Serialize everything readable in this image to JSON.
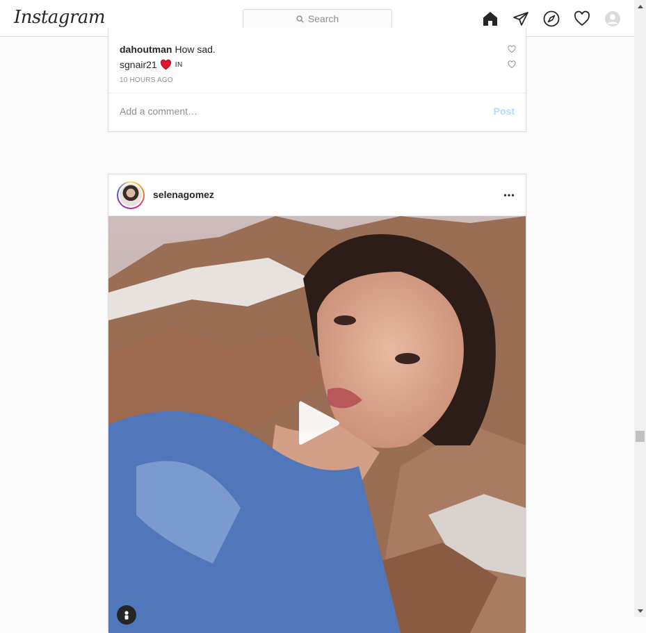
{
  "app": {
    "logo": "Instagram"
  },
  "search": {
    "placeholder": "Search"
  },
  "nav_icons": [
    "home-icon",
    "direct-icon",
    "explore-icon",
    "activity-heart-icon",
    "profile-avatar-icon"
  ],
  "previous_post": {
    "comments": [
      {
        "user": "dahoutman",
        "text": "How sad."
      },
      {
        "user": "sgnair21",
        "emoji": "❤️",
        "text": "IN"
      }
    ],
    "timestamp": "10 HOURS AGO",
    "add_comment_placeholder": "Add a comment…",
    "post_button": "Post"
  },
  "post": {
    "username": "selenagomez",
    "more_icon": "more-options-icon",
    "media_type": "video",
    "overlay_icons": [
      "play-icon",
      "user-tag-icon"
    ]
  },
  "colors": {
    "accent": "#0095f6",
    "post_disabled": "#b3dbff",
    "border": "#dbdbdb",
    "bg": "#fafafa"
  }
}
